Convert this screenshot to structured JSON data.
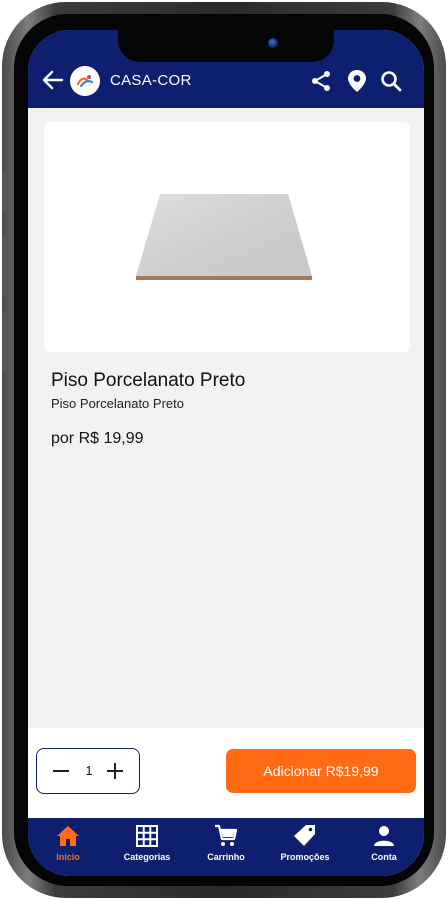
{
  "header": {
    "title": "CASA-COR"
  },
  "product": {
    "name": "Piso Porcelanato Preto",
    "subtitle": "Piso Porcelanato Preto",
    "price": "por R$ 19,99"
  },
  "purchase": {
    "quantity": "1",
    "add_button_label": "Adicionar R$19,99"
  },
  "nav": {
    "items": [
      {
        "label": "Início",
        "active": true
      },
      {
        "label": "Categorias"
      },
      {
        "label": "Carrinho"
      },
      {
        "label": "Promoções"
      },
      {
        "label": "Conta"
      }
    ]
  },
  "colors": {
    "brand_navy": "#0d1f6e",
    "accent_orange": "#ff6a13"
  }
}
